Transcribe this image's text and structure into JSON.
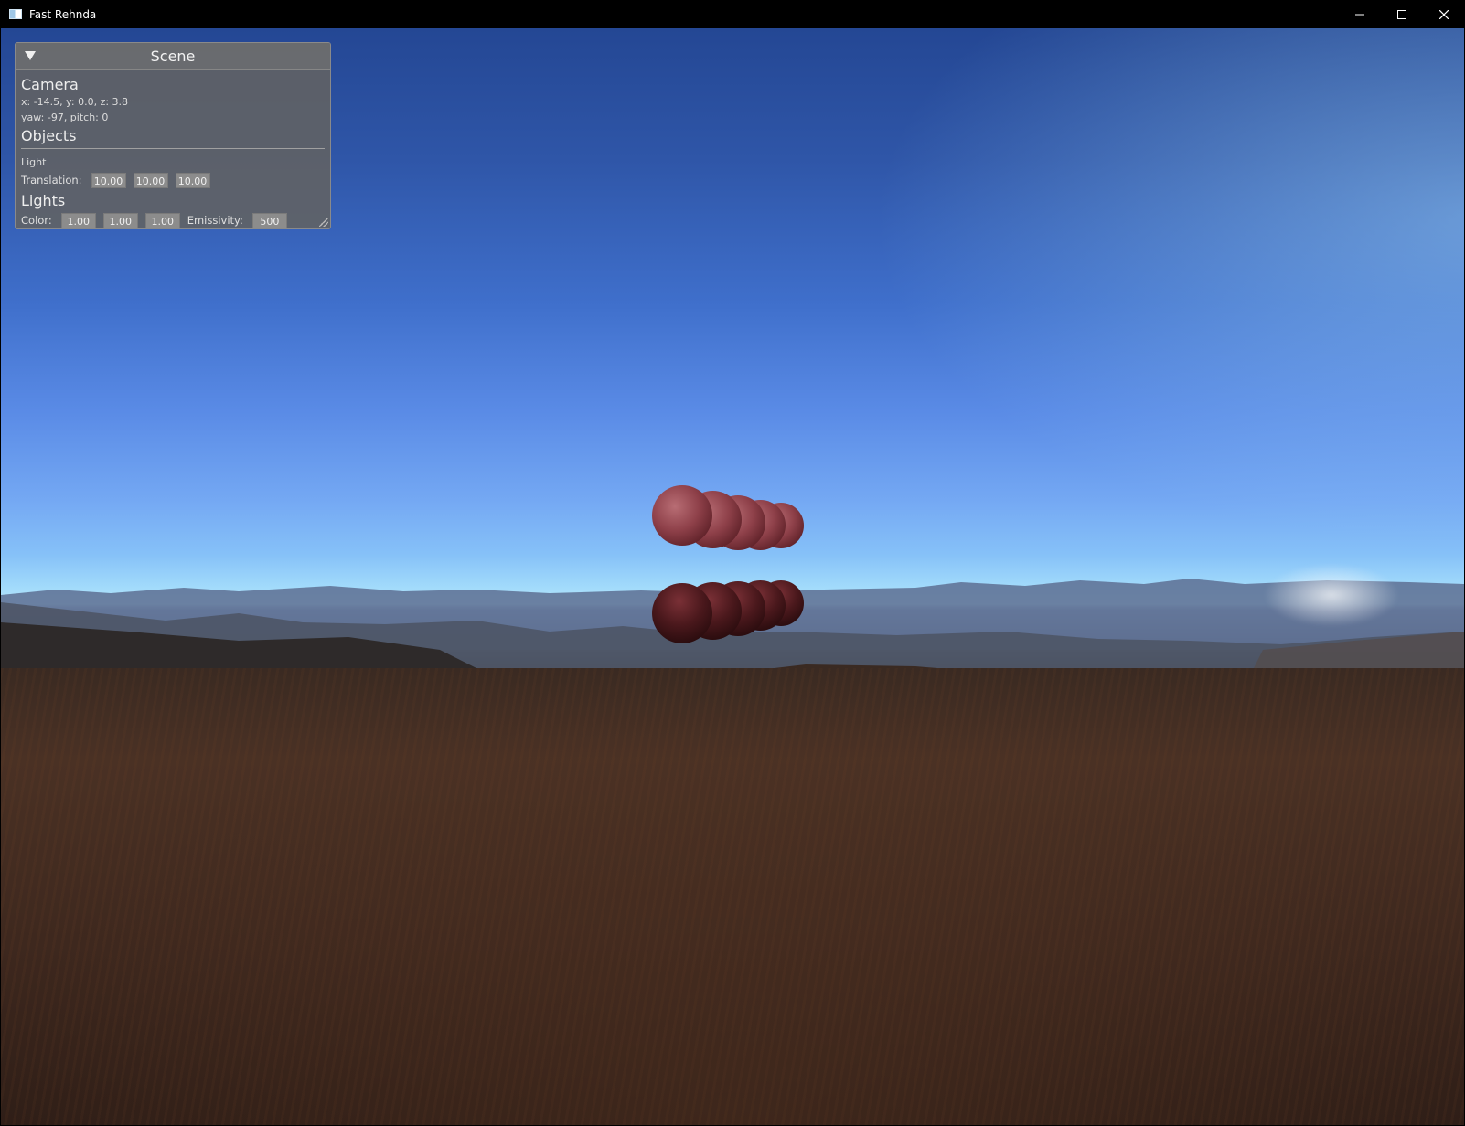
{
  "window": {
    "title": "Fast Rehnda",
    "controls": {
      "minimize": "minimize-icon",
      "maximize": "maximize-icon",
      "close": "close-icon"
    }
  },
  "panel": {
    "title": "Scene",
    "camera": {
      "heading": "Camera",
      "position": "x: -14.5, y: 0.0, z: 3.8",
      "orientation": "yaw: -97, pitch: 0"
    },
    "objects": {
      "heading": "Objects",
      "name": "Light",
      "translation_label": "Translation:",
      "translation": [
        "10.00",
        "10.00",
        "10.00"
      ]
    },
    "lights": {
      "heading": "Lights",
      "color_label": "Color:",
      "color": [
        "1.00",
        "1.00",
        "1.00"
      ],
      "emissivity_label": "Emissivity:",
      "emissivity": "500"
    }
  }
}
